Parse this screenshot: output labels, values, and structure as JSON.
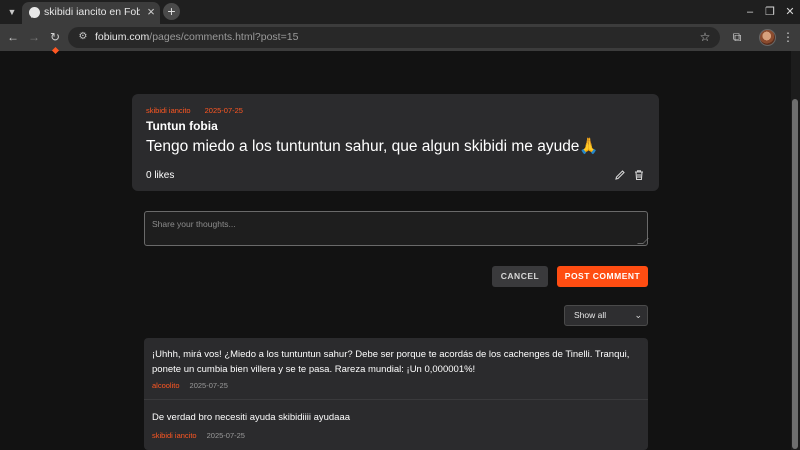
{
  "browser": {
    "tab_title": "skibidi iancito en Fobium",
    "url_host": "fobium.com",
    "url_path": "/pages/comments.html?post=15"
  },
  "post": {
    "author": "skibidi iancito",
    "date": "2025-07-25",
    "title": "Tuntun fobia",
    "body": "Tengo miedo a los tuntuntun sahur, que algun skibidi me ayude🙏",
    "likes": "0 likes"
  },
  "comment_form": {
    "placeholder": "Share your thoughts...",
    "cancel_label": "CANCEL",
    "submit_label": "POST COMMENT"
  },
  "filter": {
    "selected": "Show all"
  },
  "comments": [
    {
      "text": "¡Uhhh, mirá vos! ¿Miedo a los tuntuntun sahur? Debe ser porque te acordás de los cachenges de Tinelli. Tranqui, ponete un cumbia bien villera y se te pasa. Rareza mundial: ¡Un 0,000001%!",
      "author": "alcoolito",
      "date": "2025-07-25"
    },
    {
      "text": "De verdad bro necesiti ayuda skibidiiii ayudaaa",
      "author": "skibidi iancito",
      "date": "2025-07-25"
    }
  ],
  "colors": {
    "accent": "#ff4d12",
    "card": "#2b2b2d",
    "page_bg": "#121212"
  }
}
